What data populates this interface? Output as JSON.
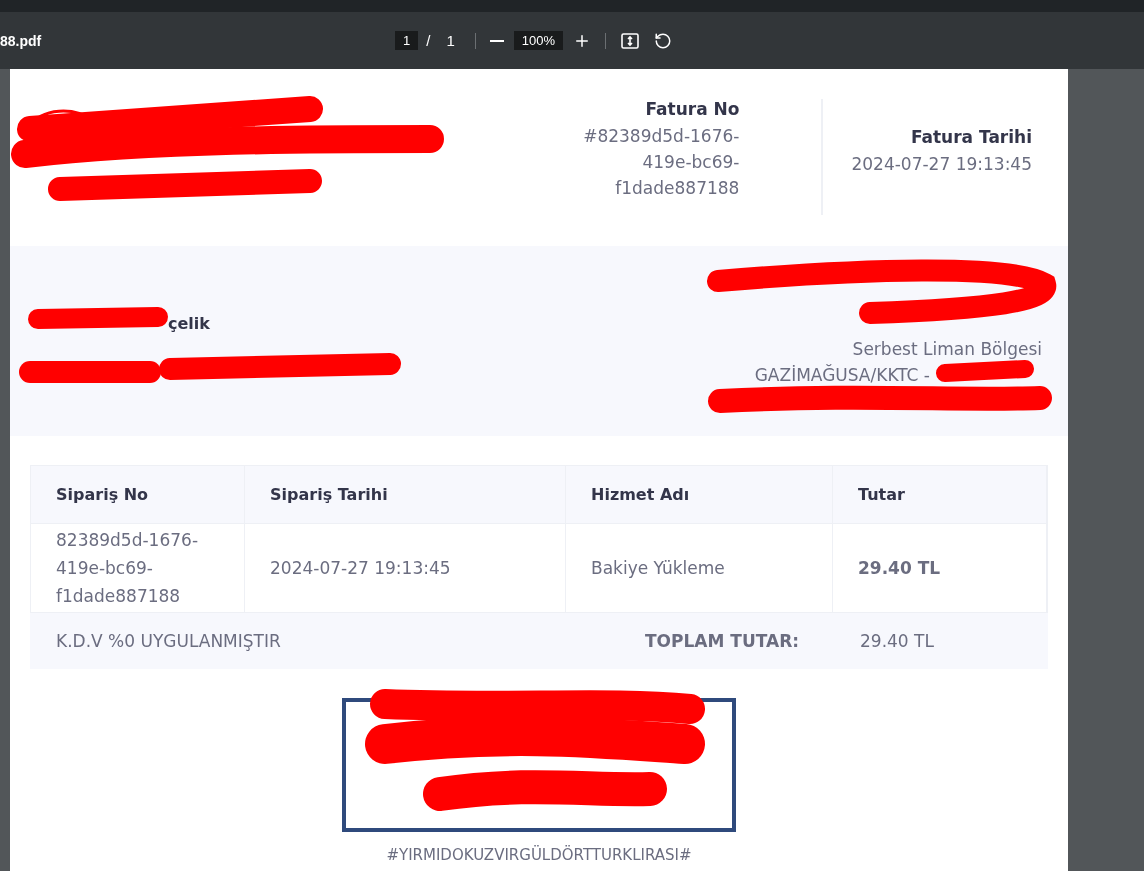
{
  "viewer": {
    "filename": "88.pdf",
    "page_input": "1",
    "page_separator": "/",
    "page_count": "1",
    "zoom": "100%"
  },
  "invoice": {
    "number_label": "Fatura No",
    "number": "#82389d5d-1676-419e-bc69-f1dade887188",
    "date_label": "Fatura Tarihi",
    "date": "2024-07-27 19:13:45"
  },
  "customer": {
    "name_fragment": "çelik"
  },
  "seller": {
    "lines": [
      "Serbest Liman Bölgesi",
      "GAZİMAĞUSA/KKTC -"
    ]
  },
  "table": {
    "columns": [
      "Sipariş No",
      "Sipariş Tarihi",
      "Hizmet Adı",
      "Tutar"
    ],
    "rows": [
      {
        "cells": [
          "82389d5d-1676-419e-bc69-f1dade887188",
          "2024-07-27 19:13:45",
          "Bakiye Yükleme",
          "29.40 TL"
        ]
      }
    ],
    "summary": {
      "note": "K.D.V %0 UYGULANMIŞTIR",
      "total_label": "TOPLAM TUTAR:",
      "total": "29.40 TL"
    }
  },
  "amount_in_words": "#YIRMIDOKUZVIRGÜLDÖRTTURKLIRASI#"
}
